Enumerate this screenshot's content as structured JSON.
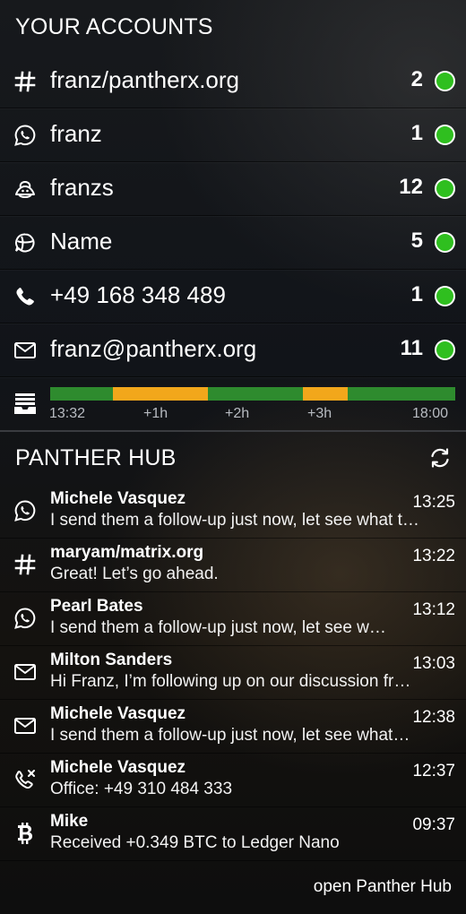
{
  "accounts_section": {
    "title": "YOUR ACCOUNTS"
  },
  "accounts": [
    {
      "icon": "hash-icon",
      "name": "franz/pantherx.org",
      "count": "2",
      "status_color": "#2fbf1f"
    },
    {
      "icon": "whatsapp-icon",
      "name": "franz",
      "count": "1",
      "status_color": "#2fbf1f"
    },
    {
      "icon": "mastodon-icon",
      "name": "franzs",
      "count": "12",
      "status_color": "#2fbf1f"
    },
    {
      "icon": "chat-globe-icon",
      "name": "Name",
      "count": "5",
      "status_color": "#2fbf1f"
    },
    {
      "icon": "phone-icon",
      "name": "+49 168 348 489",
      "count": "1",
      "status_color": "#2fbf1f"
    },
    {
      "icon": "mail-icon",
      "name": "franz@pantherx.org",
      "count": "11",
      "status_color": "#2fbf1f"
    }
  ],
  "timeline": {
    "icon": "inbox-tray-icon",
    "segments": [
      {
        "state": "ok",
        "color": "#2e8b2e",
        "fraction": 0.155
      },
      {
        "state": "busy",
        "color": "#f2a71b",
        "fraction": 0.235
      },
      {
        "state": "ok",
        "color": "#2e8b2e",
        "fraction": 0.235
      },
      {
        "state": "busy",
        "color": "#f2a71b",
        "fraction": 0.11
      },
      {
        "state": "ok",
        "color": "#2e8b2e",
        "fraction": 0.265
      }
    ],
    "ticks": [
      "13:32",
      "+1h",
      "+2h",
      "+3h",
      "18:00"
    ]
  },
  "hub": {
    "title": "PANTHER HUB",
    "refresh_icon": "refresh-icon",
    "open_label": "open Panther Hub",
    "messages": [
      {
        "icon": "whatsapp-icon",
        "sender": "Michele Vasquez",
        "time": "13:25",
        "text": "I send them a follow-up just now, let see what they say"
      },
      {
        "icon": "hash-icon",
        "sender": "maryam/matrix.org",
        "time": "13:22",
        "text": "Great! Let’s go ahead."
      },
      {
        "icon": "whatsapp-icon",
        "sender": "Pearl Bates",
        "time": "13:12",
        "text": "I send them a follow-up just now, let see what they say"
      },
      {
        "icon": "mail-icon",
        "sender": "Milton Sanders",
        "time": "13:03",
        "text": "Hi Franz, I’m following up on our discussion from last week"
      },
      {
        "icon": "mail-icon",
        "sender": "Michele Vasquez",
        "time": "12:38",
        "text": "I send them a follow-up just now, let see what they say"
      },
      {
        "icon": "missed-call-icon",
        "sender": "Michele Vasquez",
        "time": "12:37",
        "text": "Office: +49 310 484 333"
      },
      {
        "icon": "bitcoin-icon",
        "sender": "Mike",
        "time": "09:37",
        "text": "Received +0.349 BTC to Ledger Nano"
      }
    ]
  }
}
